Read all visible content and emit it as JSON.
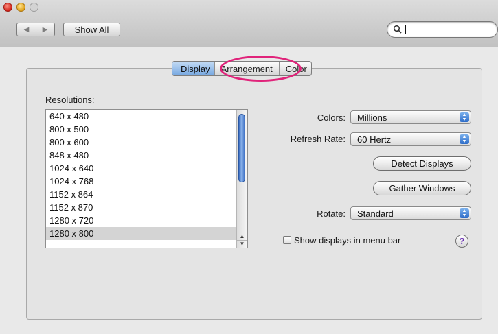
{
  "toolbar": {
    "back_icon": "◀",
    "forward_icon": "▶",
    "show_all_label": "Show All",
    "search_value": ""
  },
  "tabs": [
    {
      "label": "Display",
      "selected": true
    },
    {
      "label": "Arrangement",
      "selected": false
    },
    {
      "label": "Color",
      "selected": false
    }
  ],
  "resolutions": {
    "label": "Resolutions:",
    "items": [
      "640 x 480",
      "800 x 500",
      "800 x 600",
      "848 x 480",
      "1024 x 640",
      "1024 x 768",
      "1152 x 864",
      "1152 x 870",
      "1280 x 720",
      "1280 x 800"
    ],
    "selected": "1280 x 800"
  },
  "settings": {
    "colors_label": "Colors:",
    "colors_value": "Millions",
    "refresh_label": "Refresh Rate:",
    "refresh_value": "60 Hertz",
    "detect_label": "Detect Displays",
    "gather_label": "Gather Windows",
    "rotate_label": "Rotate:",
    "rotate_value": "Standard",
    "menu_bar_label": "Show displays in menu bar",
    "menu_bar_checked": false,
    "help_label": "?"
  },
  "colors": {
    "accent_blue": "#76a7e0",
    "annotation_ring": "#e0237a"
  }
}
